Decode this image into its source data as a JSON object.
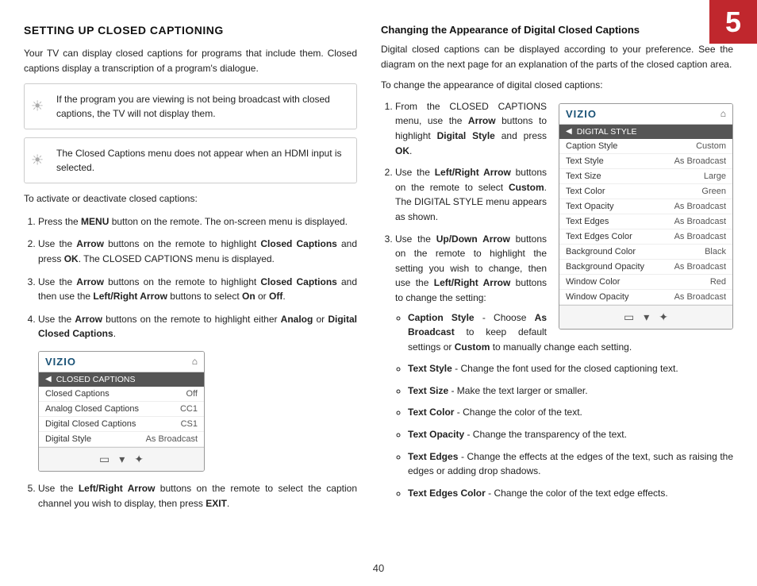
{
  "chapter": {
    "number": "5"
  },
  "page_number": "40",
  "left": {
    "section_title": "SETTING UP CLOSED CAPTIONING",
    "intro_text": "Your TV can display closed captions for programs that include them. Closed captions display a transcription of a program's dialogue.",
    "info_box_1": "If the program you are viewing is not being broadcast with closed captions, the TV will not display them.",
    "info_box_2": "The Closed Captions menu does not appear when an HDMI input is selected.",
    "activate_label": "To activate or deactivate closed captions:",
    "steps": [
      {
        "text": "Press the MENU button on the remote. The on-screen menu is displayed.",
        "bold_word": "MENU"
      },
      {
        "text": "Use the Arrow buttons on the remote to highlight Closed Captions and press OK. The CLOSED CAPTIONS menu is displayed.",
        "bold_words": [
          "Arrow",
          "Closed Captions",
          "OK"
        ]
      },
      {
        "text": "Use the Arrow buttons on the remote to highlight Closed Captions and then use the Left/Right Arrow buttons to select On or Off.",
        "bold_words": [
          "Arrow",
          "Closed Captions",
          "Left/Right Arrow",
          "On",
          "Off"
        ]
      },
      {
        "text": "Use the Arrow buttons on the remote to highlight either Analog or Digital Closed Captions.",
        "bold_words": [
          "Arrow",
          "Analog",
          "Digital Closed Captions"
        ]
      },
      {
        "text": "Use the Left/Right Arrow buttons on the remote to select the caption channel you wish to display, then press EXIT.",
        "bold_words": [
          "Left/Right Arrow",
          "EXIT"
        ]
      }
    ],
    "vizio_menu_left": {
      "logo": "VIZIO",
      "tab": "CLOSED CAPTIONS",
      "rows": [
        {
          "label": "Closed Captions",
          "value": "Off"
        },
        {
          "label": "Analog Closed Captions",
          "value": "CC1"
        },
        {
          "label": "Digital Closed Captions",
          "value": "CS1"
        },
        {
          "label": "Digital Style",
          "value": "As Broadcast"
        }
      ]
    }
  },
  "right": {
    "title": "Changing the Appearance of Digital Closed Captions",
    "intro": "Digital closed captions can be displayed according to your preference. See the diagram on the next page for an explanation of the parts of the closed caption area.",
    "change_label": "To change the appearance of digital closed captions:",
    "steps": [
      {
        "text": "From the CLOSED CAPTIONS menu, use the Arrow buttons to highlight Digital Style and press OK.",
        "bold_words": [
          "Arrow",
          "Digital Style",
          "OK"
        ]
      },
      {
        "text": "Use the Left/Right Arrow buttons on the remote to select Custom. The DIGITAL STYLE menu appears as shown.",
        "bold_words": [
          "Left/Right Arrow",
          "Custom"
        ]
      },
      {
        "text": "Use the Up/Down Arrow buttons on the remote to highlight the setting you wish to change, then use the Left/Right Arrow buttons to change the setting:",
        "bold_words": [
          "Up/Down Arrow",
          "Left/Right Arrow"
        ]
      }
    ],
    "vizio_menu_right": {
      "logo": "VIZIO",
      "tab": "DIGITAL STYLE",
      "rows": [
        {
          "label": "Caption Style",
          "value": "Custom"
        },
        {
          "label": "Text Style",
          "value": "As Broadcast"
        },
        {
          "label": "Text Size",
          "value": "Large"
        },
        {
          "label": "Text Color",
          "value": "Green"
        },
        {
          "label": "Text Opacity",
          "value": "As Broadcast"
        },
        {
          "label": "Text Edges",
          "value": "As Broadcast"
        },
        {
          "label": "Text Edges Color",
          "value": "As Broadcast"
        },
        {
          "label": "Background Color",
          "value": "Black"
        },
        {
          "label": "Background Opacity",
          "value": "As Broadcast"
        },
        {
          "label": "Window Color",
          "value": "Red"
        },
        {
          "label": "Window Opacity",
          "value": "As Broadcast"
        }
      ]
    },
    "bullets": [
      {
        "label": "Caption Style",
        "desc": " - Choose As Broadcast to keep default settings or Custom to manually change each setting.",
        "bold_in_desc": [
          "As Broadcast",
          "Custom"
        ]
      },
      {
        "label": "Text Style",
        "desc": "  - Change the font used for the closed captioning text."
      },
      {
        "label": "Text Size",
        "desc": " - Make the text larger or smaller."
      },
      {
        "label": "Text Color",
        "desc": " - Change the color of the text."
      },
      {
        "label": "Text Opacity",
        "desc": " - Change the transparency of the text."
      },
      {
        "label": "Text Edges",
        "desc": " - Change the effects at the edges of the text, such as raising the edges or adding drop shadows."
      },
      {
        "label": "Text Edges Color",
        "desc": " - Change the color of the text edge effects."
      }
    ]
  }
}
